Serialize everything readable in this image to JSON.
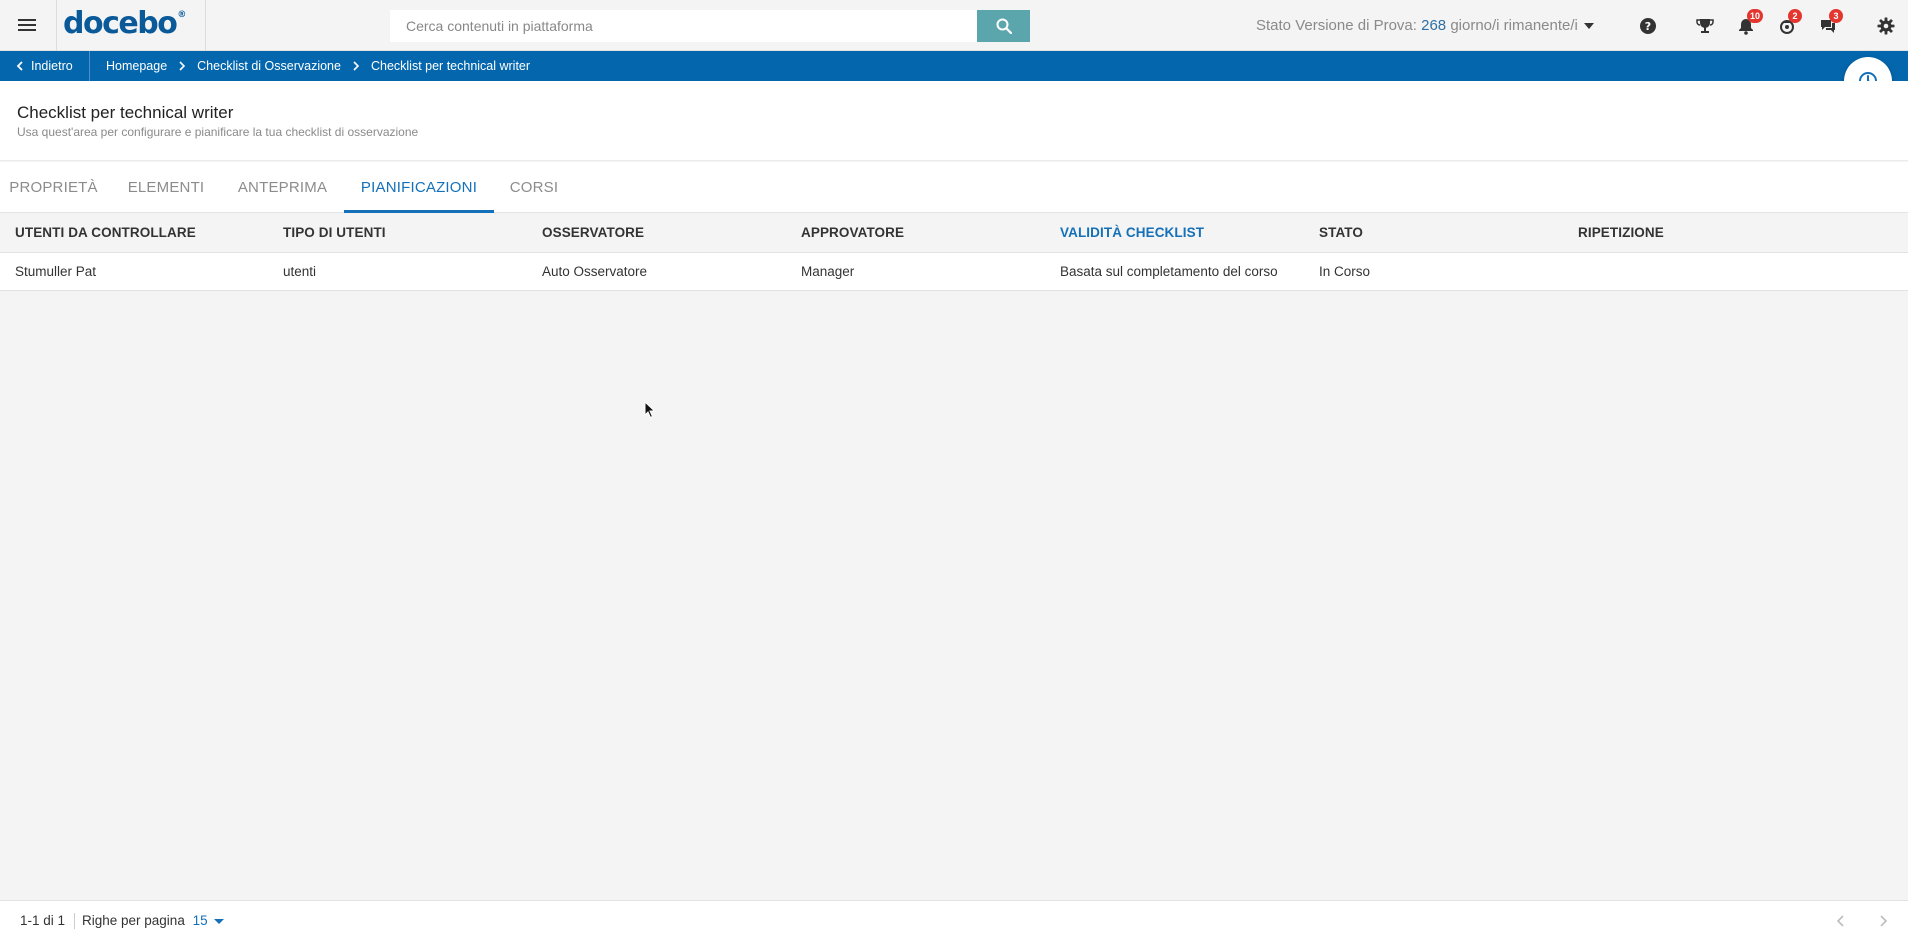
{
  "header": {
    "logo_text": "docebo",
    "logo_mark": "®",
    "search": {
      "placeholder": "Cerca contenuti in piattaforma"
    },
    "trial": {
      "prefix": "Stato Versione di Prova:",
      "days": "268",
      "suffix": "giorno/i rimanente/i"
    },
    "badges": {
      "notifications": "10",
      "apps": "2",
      "messages": "3"
    },
    "icons": [
      "menu-icon",
      "search-icon",
      "help-icon",
      "trophy-icon",
      "bell-icon",
      "rocket-icon",
      "chat-icon",
      "gear-icon"
    ]
  },
  "breadcrumb": {
    "back_label": "Indietro",
    "items": [
      "Homepage",
      "Checklist di Osservazione",
      "Checklist per technical writer"
    ]
  },
  "page": {
    "title": "Checklist per technical writer",
    "subtitle": "Usa quest'area per configurare e pianificare la tua checklist di osservazione"
  },
  "tabs": [
    {
      "label": "PROPRIETÀ",
      "active": false
    },
    {
      "label": "ELEMENTI",
      "active": false
    },
    {
      "label": "ANTEPRIMA",
      "active": false
    },
    {
      "label": "PIANIFICAZIONI",
      "active": true
    },
    {
      "label": "CORSI",
      "active": false
    }
  ],
  "table": {
    "columns": [
      "UTENTI DA CONTROLLARE",
      "TIPO DI UTENTI",
      "OSSERVATORE",
      "APPROVATORE",
      "VALIDITÀ CHECKLIST",
      "STATO",
      "RIPETIZIONE"
    ],
    "sorted_column": "VALIDITÀ CHECKLIST",
    "rows": [
      [
        "Stumuller Pat",
        "utenti",
        "Auto Osservatore",
        "Manager",
        "Basata sul completamento del corso",
        "In Corso",
        ""
      ]
    ]
  },
  "footer": {
    "count": "1-1 di 1",
    "rows_label": "Righe per pagina",
    "rows_value": "15"
  },
  "colors": {
    "brand_blue": "#0467ae",
    "accent_blue": "#1470b8",
    "search_button": "#5ba6ad",
    "badge_red": "#e2362f"
  }
}
